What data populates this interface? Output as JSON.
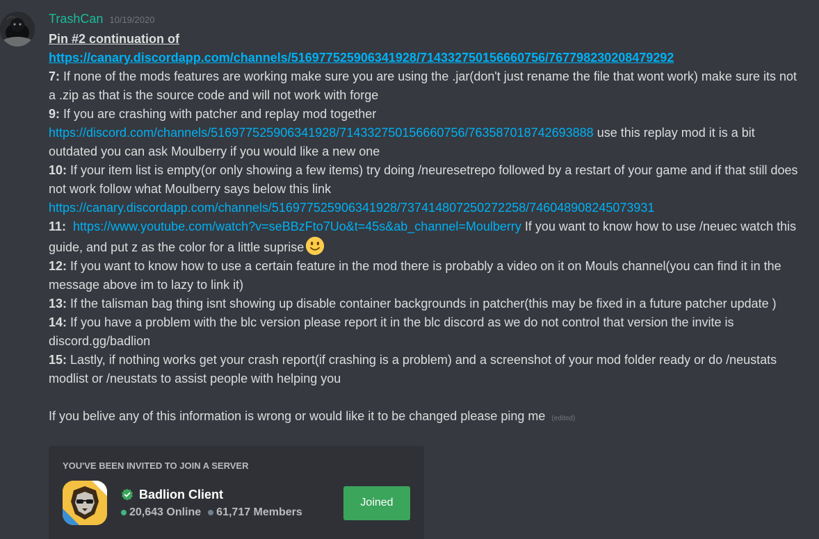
{
  "message": {
    "username": "TrashCan",
    "timestamp": "10/19/2020",
    "pin_title": "Pin #2 continuation of ",
    "pin_link": "https://canary.discordapp.com/channels/516977525906341928/714332750156660756/767798230208479292 ",
    "items": {
      "n7": "7:",
      "t7": " If none of the mods features are working make sure you are using the .jar(don't just rename the file that wont work) make sure its not a .zip as that is the source code and will not work with forge",
      "n9": "9:",
      "t9a": " If you are crashing with patcher and replay mod together",
      "l9": "https://discord.com/channels/516977525906341928/714332750156660756/763587018742693888",
      "t9b": " use this replay mod it is a bit outdated you can ask Moulberry if you would like a new one",
      "n10": "10:",
      "t10": " If your item list is empty(or only showing a few items) try doing /neuresetrepo followed by a restart of your game and if that still does not work follow what Moulberry says below this link",
      "l10": "https://canary.discordapp.com/channels/516977525906341928/737414807250272258/746048908245073931",
      "n11": "11:",
      "l11": "https://www.youtube.com/watch?v=seBBzFto7Uo&t=45s&ab_channel=Moulberry",
      "t11": " If you want to know how to use /neuec watch this guide, and put z as the color for a little suprise",
      "n12": "12:",
      "t12": " If you want to know how to use a certain feature in the mod there is probably a video on it on Mouls channel(you can find it in the message above im to lazy to link it)",
      "n13": "13:",
      "t13": " If the talisman bag thing isnt showing up disable container backgrounds in patcher(this may be fixed in a future patcher update )",
      "n14": "14:",
      "t14": " If you have a problem with the blc version please report it in the blc discord as we do not control that version the invite is discord.gg/badlion",
      "n15": "15:",
      "t15": " Lastly, if nothing works get your crash report(if crashing is a problem) and a screenshot of your mod folder ready or do /neustats modlist or /neustats to assist people with helping you"
    },
    "closing": "If you belive any of this information is wrong or would like it to be changed please ping me",
    "edited": "(edited)",
    "emoji": "slightly-smiling-face-icon"
  },
  "invite": {
    "header": "YOU'VE BEEN INVITED TO JOIN A SERVER",
    "server_name": "Badlion Client",
    "online": "20,643 Online",
    "members": "61,717 Members",
    "button": "Joined",
    "verified_icon": "verified-check-icon"
  },
  "colors": {
    "background": "#36393f",
    "username": "#1abc9c",
    "link": "#00b0f4",
    "joined_button": "#3ba55c",
    "online_dot": "#43b581"
  }
}
